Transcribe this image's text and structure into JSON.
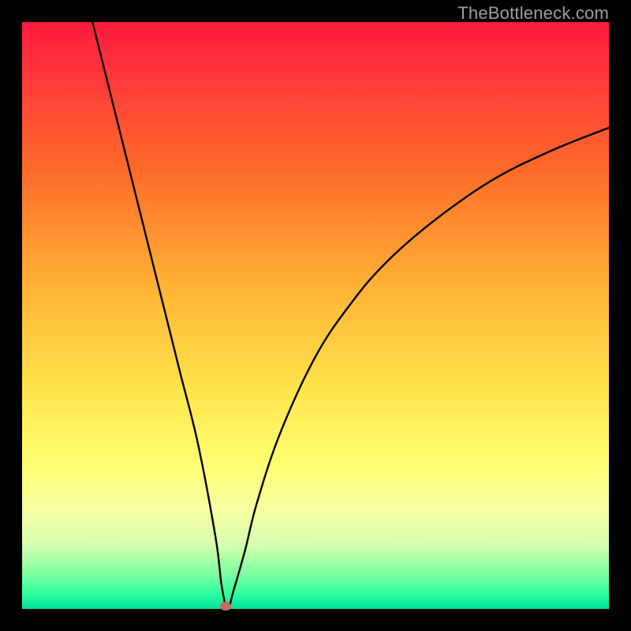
{
  "watermark": {
    "text": "TheBottleneck.com"
  },
  "chart_data": {
    "type": "line",
    "title": "",
    "xlabel": "",
    "ylabel": "",
    "xlim": [
      0,
      100
    ],
    "ylim": [
      0,
      100
    ],
    "grid": false,
    "series": [
      {
        "name": "bottleneck-curve",
        "x": [
          12,
          15,
          18,
          21,
          24,
          27,
          30,
          33,
          34,
          35,
          36,
          38,
          40,
          44,
          50,
          56,
          62,
          70,
          80,
          90,
          100
        ],
        "values": [
          100,
          88,
          76,
          64,
          52,
          40,
          28,
          12,
          4,
          0,
          3,
          10,
          18,
          30,
          43,
          52,
          59,
          66,
          73,
          78,
          82
        ]
      }
    ],
    "marker": {
      "name": "bottleneck-marker",
      "x": 34.7,
      "y": 0.5
    },
    "background_gradient": {
      "stops": [
        {
          "pos": 0,
          "color": "#ff1a3c"
        },
        {
          "pos": 0.1,
          "color": "#ff3a3a"
        },
        {
          "pos": 0.25,
          "color": "#ff6a2a"
        },
        {
          "pos": 0.45,
          "color": "#ffb234"
        },
        {
          "pos": 0.62,
          "color": "#ffe24b"
        },
        {
          "pos": 0.75,
          "color": "#ffff70"
        },
        {
          "pos": 0.83,
          "color": "#f7ffa2"
        },
        {
          "pos": 0.89,
          "color": "#d6ffb0"
        },
        {
          "pos": 0.94,
          "color": "#7dffa0"
        },
        {
          "pos": 0.975,
          "color": "#2effa0"
        },
        {
          "pos": 1.0,
          "color": "#00e09a"
        }
      ]
    }
  }
}
